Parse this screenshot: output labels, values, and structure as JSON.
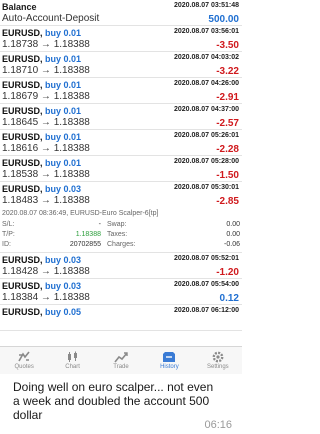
{
  "balance": {
    "label": "Balance",
    "time": "2020.08.07 03:51:48",
    "sub": "Auto-Account-Deposit",
    "value": "500.00"
  },
  "trades_top": [
    {
      "symbol": "EURUSD,",
      "side": "buy 0.01",
      "prices": "1.18738 → 1.18388",
      "time": "2020.08.07 03:56:01",
      "pnl": "-3.50"
    },
    {
      "symbol": "EURUSD,",
      "side": "buy 0.01",
      "prices": "1.18710 → 1.18388",
      "time": "2020.08.07 04:03:02",
      "pnl": "-3.22"
    },
    {
      "symbol": "EURUSD,",
      "side": "buy 0.01",
      "prices": "1.18679 → 1.18388",
      "time": "2020.08.07 04:26:00",
      "pnl": "-2.91"
    },
    {
      "symbol": "EURUSD,",
      "side": "buy 0.01",
      "prices": "1.18645 → 1.18388",
      "time": "2020.08.07 04:37:00",
      "pnl": "-2.57"
    },
    {
      "symbol": "EURUSD,",
      "side": "buy 0.01",
      "prices": "1.18616 → 1.18388",
      "time": "2020.08.07 05:26:01",
      "pnl": "-2.28"
    },
    {
      "symbol": "EURUSD,",
      "side": "buy 0.01",
      "prices": "1.18538 → 1.18388",
      "time": "2020.08.07 05:28:00",
      "pnl": "-1.50"
    },
    {
      "symbol": "EURUSD,",
      "side": "buy 0.03",
      "prices": "1.18483 → 1.18388",
      "time": "2020.08.07 05:30:01",
      "pnl": "-2.85"
    }
  ],
  "details": {
    "comment": "2020.08.07 08:36:49, EURUSD-Euro Scalper-6[tp]",
    "sl_label": "S/L:",
    "sl_value": "-",
    "swap_label": "Swap:",
    "swap_value": "0.00",
    "tp_label": "T/P:",
    "tp_value": "1.18388",
    "taxes_label": "Taxes:",
    "taxes_value": "0.00",
    "id_label": "ID:",
    "id_value": "20702855",
    "charges_label": "Charges:",
    "charges_value": "-0.06"
  },
  "trades_bottom": [
    {
      "symbol": "EURUSD,",
      "side": "buy 0.03",
      "prices": "1.18428 → 1.18388",
      "time": "2020.08.07 05:52:01",
      "pnl": "-1.20"
    },
    {
      "symbol": "EURUSD,",
      "side": "buy 0.03",
      "prices": "1.18384 → 1.18388",
      "time": "2020.08.07 05:54:00",
      "pnl": "0.12"
    },
    {
      "symbol": "EURUSD,",
      "side": "buy 0.05",
      "prices": "",
      "time": "2020.08.07 06:12:00",
      "pnl": ""
    }
  ],
  "tabs": [
    {
      "label": "Quotes",
      "icon": "quotes-icon"
    },
    {
      "label": "Chart",
      "icon": "chart-icon"
    },
    {
      "label": "Trade",
      "icon": "trade-icon"
    },
    {
      "label": "History",
      "icon": "history-icon",
      "active": true
    },
    {
      "label": "Settings",
      "icon": "settings-icon"
    }
  ],
  "chat": {
    "text": "Doing well on euro scalper... not even a week and doubled the account 500 dollar",
    "time": "06:16"
  },
  "colors": {
    "negative": "#d0191d",
    "positive": "#1f6fd1",
    "tp": "#2a9d3a",
    "tab_active": "#3a7bd5",
    "tab_inactive": "#8a8a8a"
  }
}
